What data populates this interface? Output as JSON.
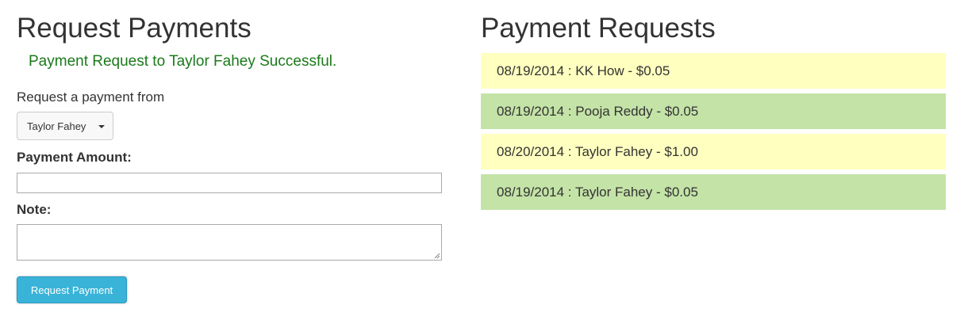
{
  "left": {
    "title": "Request Payments",
    "success_message": "Payment Request to Taylor Fahey Successful.",
    "from_label": "Request a payment from",
    "from_selected": "Taylor Fahey",
    "amount_label": "Payment Amount:",
    "amount_value": "",
    "note_label": "Note:",
    "note_value": "",
    "submit_label": "Request Payment"
  },
  "right": {
    "title": "Payment Requests",
    "requests": [
      {
        "text": "08/19/2014 : KK How - $0.05",
        "status": "pending",
        "color": "#ffffc0"
      },
      {
        "text": "08/19/2014 : Pooja Reddy - $0.05",
        "status": "paid",
        "color": "#c4e3a7"
      },
      {
        "text": "08/20/2014 : Taylor Fahey - $1.00",
        "status": "pending",
        "color": "#ffffc0"
      },
      {
        "text": "08/19/2014 : Taylor Fahey - $0.05",
        "status": "paid",
        "color": "#c4e3a7"
      }
    ]
  },
  "colors": {
    "success_text": "#1a7a1a",
    "button": "#39b3d7",
    "pending_bg": "#ffffc0",
    "paid_bg": "#c4e3a7"
  }
}
